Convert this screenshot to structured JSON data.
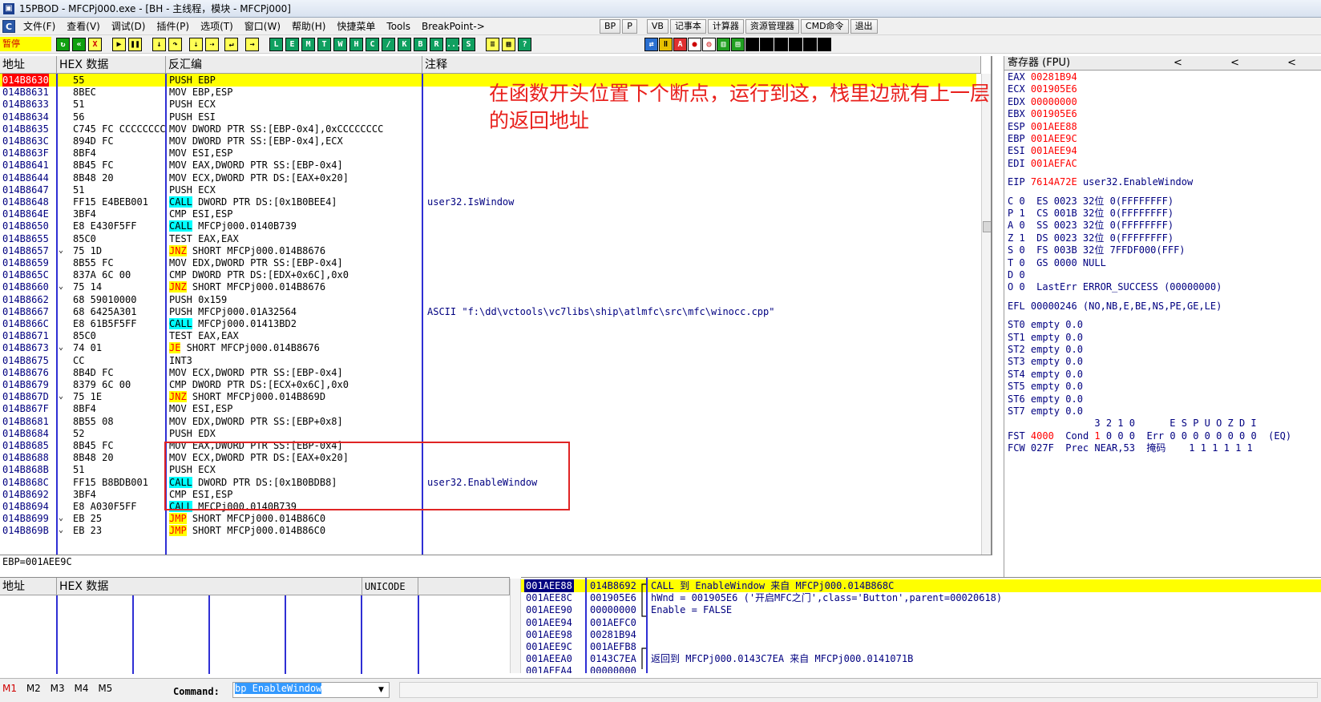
{
  "window": {
    "title": "15PBOD - MFCPj000.exe - [BH - 主线程，模块 - MFCPj000]"
  },
  "menu": {
    "items": [
      "文件(F)",
      "查看(V)",
      "调试(D)",
      "插件(P)",
      "选项(T)",
      "窗口(W)",
      "帮助(H)",
      "快捷菜单",
      "Tools",
      "BreakPoint->"
    ],
    "tool_buttons": [
      "BP",
      "P",
      "VB",
      "记事本",
      "计算器",
      "资源管理器",
      "CMD命令",
      "退出"
    ]
  },
  "toolbar": {
    "status": "暂停",
    "letters": [
      "L",
      "E",
      "M",
      "T",
      "W",
      "H",
      "C",
      "/",
      "K",
      "B",
      "R",
      "...",
      "S"
    ]
  },
  "disasm": {
    "headers": {
      "address": "地址",
      "hex": "HEX 数据",
      "disasm": "反汇编",
      "comment": "注释"
    },
    "rows": [
      {
        "addr": "014B8630",
        "mark": "",
        "hex": "55",
        "kw": "",
        "asm": "PUSH EBP",
        "cmt": "",
        "eip": true
      },
      {
        "addr": "014B8631",
        "mark": "",
        "hex": "8BEC",
        "kw": "",
        "asm": "MOV EBP,ESP",
        "cmt": ""
      },
      {
        "addr": "014B8633",
        "mark": "",
        "hex": "51",
        "kw": "",
        "asm": "PUSH ECX",
        "cmt": ""
      },
      {
        "addr": "014B8634",
        "mark": "",
        "hex": "56",
        "kw": "",
        "asm": "PUSH ESI",
        "cmt": ""
      },
      {
        "addr": "014B8635",
        "mark": "",
        "hex": "C745 FC CCCCCCCC",
        "kw": "",
        "asm": "MOV DWORD PTR SS:[EBP-0x4],0xCCCCCCCC",
        "cmt": ""
      },
      {
        "addr": "014B863C",
        "mark": "",
        "hex": "894D FC",
        "kw": "",
        "asm": "MOV DWORD PTR SS:[EBP-0x4],ECX",
        "cmt": ""
      },
      {
        "addr": "014B863F",
        "mark": "",
        "hex": "8BF4",
        "kw": "",
        "asm": "MOV ESI,ESP",
        "cmt": ""
      },
      {
        "addr": "014B8641",
        "mark": "",
        "hex": "8B45 FC",
        "kw": "",
        "asm": "MOV EAX,DWORD PTR SS:[EBP-0x4]",
        "cmt": ""
      },
      {
        "addr": "014B8644",
        "mark": "",
        "hex": "8B48 20",
        "kw": "",
        "asm": "MOV ECX,DWORD PTR DS:[EAX+0x20]",
        "cmt": ""
      },
      {
        "addr": "014B8647",
        "mark": "",
        "hex": "51",
        "kw": "",
        "asm": "PUSH ECX",
        "cmt": ""
      },
      {
        "addr": "014B8648",
        "mark": "",
        "hex": "FF15 E4BEB001",
        "kw": "CALL",
        "kwtype": "call",
        "asm": " DWORD PTR DS:[0x1B0BEE4]",
        "cmt": "user32.IsWindow"
      },
      {
        "addr": "014B864E",
        "mark": "",
        "hex": "3BF4",
        "kw": "",
        "asm": "CMP ESI,ESP",
        "cmt": ""
      },
      {
        "addr": "014B8650",
        "mark": "",
        "hex": "E8 E430F5FF",
        "kw": "CALL",
        "kwtype": "call",
        "asm": " MFCPj000.0140B739",
        "cmt": ""
      },
      {
        "addr": "014B8655",
        "mark": "",
        "hex": "85C0",
        "kw": "",
        "asm": "TEST EAX,EAX",
        "cmt": ""
      },
      {
        "addr": "014B8657",
        "mark": "⌄",
        "hex": "75 1D",
        "kw": "JNZ",
        "kwtype": "jmp",
        "asm": " SHORT MFCPj000.014B8676",
        "cmt": ""
      },
      {
        "addr": "014B8659",
        "mark": "",
        "hex": "8B55 FC",
        "kw": "",
        "asm": "MOV EDX,DWORD PTR SS:[EBP-0x4]",
        "cmt": ""
      },
      {
        "addr": "014B865C",
        "mark": "",
        "hex": "837A 6C 00",
        "kw": "",
        "asm": "CMP DWORD PTR DS:[EDX+0x6C],0x0",
        "cmt": ""
      },
      {
        "addr": "014B8660",
        "mark": "⌄",
        "hex": "75 14",
        "kw": "JNZ",
        "kwtype": "jmp",
        "asm": " SHORT MFCPj000.014B8676",
        "cmt": ""
      },
      {
        "addr": "014B8662",
        "mark": "",
        "hex": "68 59010000",
        "kw": "",
        "asm": "PUSH 0x159",
        "cmt": ""
      },
      {
        "addr": "014B8667",
        "mark": "",
        "hex": "68 6425A301",
        "kw": "",
        "asm": "PUSH MFCPj000.01A32564",
        "cmt": "ASCII \"f:\\dd\\vctools\\vc7libs\\ship\\atlmfc\\src\\mfc\\winocc.cpp\""
      },
      {
        "addr": "014B866C",
        "mark": "",
        "hex": "E8 61B5F5FF",
        "kw": "CALL",
        "kwtype": "call",
        "asm": " MFCPj000.01413BD2",
        "cmt": ""
      },
      {
        "addr": "014B8671",
        "mark": "",
        "hex": "85C0",
        "kw": "",
        "asm": "TEST EAX,EAX",
        "cmt": ""
      },
      {
        "addr": "014B8673",
        "mark": "⌄",
        "hex": "74 01",
        "kw": "JE",
        "kwtype": "jmp",
        "asm": " SHORT MFCPj000.014B8676",
        "cmt": ""
      },
      {
        "addr": "014B8675",
        "mark": "",
        "hex": "CC",
        "kw": "",
        "asm": "INT3",
        "cmt": ""
      },
      {
        "addr": "014B8676",
        "mark": "",
        "hex": "8B4D FC",
        "kw": "",
        "asm": "MOV ECX,DWORD PTR SS:[EBP-0x4]",
        "cmt": ""
      },
      {
        "addr": "014B8679",
        "mark": "",
        "hex": "8379 6C 00",
        "kw": "",
        "asm": "CMP DWORD PTR DS:[ECX+0x6C],0x0",
        "cmt": ""
      },
      {
        "addr": "014B867D",
        "mark": "⌄",
        "hex": "75 1E",
        "kw": "JNZ",
        "kwtype": "jmp",
        "asm": " SHORT MFCPj000.014B869D",
        "cmt": ""
      },
      {
        "addr": "014B867F",
        "mark": "",
        "hex": "8BF4",
        "kw": "",
        "asm": "MOV ESI,ESP",
        "cmt": ""
      },
      {
        "addr": "014B8681",
        "mark": "",
        "hex": "8B55 08",
        "kw": "",
        "asm": "MOV EDX,DWORD PTR SS:[EBP+0x8]",
        "cmt": ""
      },
      {
        "addr": "014B8684",
        "mark": "",
        "hex": "52",
        "kw": "",
        "asm": "PUSH EDX",
        "cmt": ""
      },
      {
        "addr": "014B8685",
        "mark": "",
        "hex": "8B45 FC",
        "kw": "",
        "asm": "MOV EAX,DWORD PTR SS:[EBP-0x4]",
        "cmt": ""
      },
      {
        "addr": "014B8688",
        "mark": "",
        "hex": "8B48 20",
        "kw": "",
        "asm": "MOV ECX,DWORD PTR DS:[EAX+0x20]",
        "cmt": ""
      },
      {
        "addr": "014B868B",
        "mark": "",
        "hex": "51",
        "kw": "",
        "asm": "PUSH ECX",
        "cmt": ""
      },
      {
        "addr": "014B868C",
        "mark": "",
        "hex": "FF15 B8BDB001",
        "kw": "CALL",
        "kwtype": "call",
        "asm": " DWORD PTR DS:[0x1B0BDB8]",
        "cmt": "user32.EnableWindow"
      },
      {
        "addr": "014B8692",
        "mark": "",
        "hex": "3BF4",
        "kw": "",
        "asm": "CMP ESI,ESP",
        "cmt": ""
      },
      {
        "addr": "014B8694",
        "mark": "",
        "hex": "E8 A030F5FF",
        "kw": "CALL",
        "kwtype": "call",
        "asm": " MFCPj000.0140B739",
        "cmt": ""
      },
      {
        "addr": "014B8699",
        "mark": "⌄",
        "hex": "EB 25",
        "kw": "JMP",
        "kwtype": "jmp",
        "asm": " SHORT MFCPj000.014B86C0",
        "cmt": ""
      },
      {
        "addr": "014B869B",
        "mark": "⌄",
        "hex": "EB 23",
        "kw": "JMP",
        "kwtype": "jmp",
        "asm": " SHORT MFCPj000.014B86C0",
        "cmt": ""
      }
    ],
    "annotation": "在函数开头位置下个断点，运行到这，栈里边就有上一层的返回地址",
    "info_line": "EBP=001AEE9C"
  },
  "registers": {
    "title": "寄存器 (FPU)",
    "arrows": "< < <",
    "gp": [
      {
        "name": "EAX",
        "value": "00281B94",
        "text": ""
      },
      {
        "name": "ECX",
        "value": "001905E6",
        "text": ""
      },
      {
        "name": "EDX",
        "value": "00000000",
        "text": ""
      },
      {
        "name": "EBX",
        "value": "001905E6",
        "text": ""
      },
      {
        "name": "ESP",
        "value": "001AEE88",
        "text": ""
      },
      {
        "name": "EBP",
        "value": "001AEE9C",
        "text": ""
      },
      {
        "name": "ESI",
        "value": "001AEE94",
        "text": ""
      },
      {
        "name": "EDI",
        "value": "001AEFAC",
        "text": ""
      }
    ],
    "eip": {
      "name": "EIP",
      "value": "7614A72E",
      "text": "user32.EnableWindow"
    },
    "flags": [
      "C 0  ES 0023 32位 0(FFFFFFFF)",
      "P 1  CS 001B 32位 0(FFFFFFFF)",
      "A 0  SS 0023 32位 0(FFFFFFFF)",
      "Z 1  DS 0023 32位 0(FFFFFFFF)",
      "S 0  FS 003B 32位 7FFDF000(FFF)",
      "T 0  GS 0000 NULL",
      "D 0",
      "O 0  LastErr ERROR_SUCCESS (00000000)"
    ],
    "efl": "EFL 00000246 (NO,NB,E,BE,NS,PE,GE,LE)",
    "fpu": [
      "ST0 empty 0.0",
      "ST1 empty 0.0",
      "ST2 empty 0.0",
      "ST3 empty 0.0",
      "ST4 empty 0.0",
      "ST5 empty 0.0",
      "ST6 empty 0.0",
      "ST7 empty 0.0"
    ],
    "fpu_hdr": "               3 2 1 0      E S P U O Z D I",
    "fst": {
      "label": "FST",
      "value": "4000",
      "rest": "  Cond ",
      "cond1": "1",
      "rest2": " 0 0 0  Err 0 0 0 0 0 0 0 0  (EQ)"
    },
    "fcw": "FCW 027F  Prec NEAR,53  掩码    1 1 1 1 1 1"
  },
  "dump": {
    "headers": {
      "address": "地址",
      "hex": "HEX 数据",
      "unicode": "UNICODE"
    }
  },
  "stack": {
    "rows": [
      {
        "addr": "001AEE88",
        "val": "014B8692",
        "cmt": "CALL 到 EnableWindow 来自 MFCPj000.014B868C",
        "top": true
      },
      {
        "addr": "001AEE8C",
        "val": "001905E6",
        "cmt": "hWnd = 001905E6 ('开启MFC之门',class='Button',parent=00020618)"
      },
      {
        "addr": "001AEE90",
        "val": "00000000",
        "cmt": "Enable = FALSE"
      },
      {
        "addr": "001AEE94",
        "val": "001AEFC0",
        "cmt": ""
      },
      {
        "addr": "001AEE98",
        "val": "00281B94",
        "cmt": ""
      },
      {
        "addr": "001AEE9C",
        "val": "001AEFB8",
        "cmt": ""
      },
      {
        "addr": "001AEEA0",
        "val": "0143C7EA",
        "cmt": "返回到 MFCPj000.0143C7EA 来自 MFCPj000.0141071B"
      },
      {
        "addr": "001AEEA4",
        "val": "00000000",
        "cmt": ""
      }
    ]
  },
  "command": {
    "tabs": [
      "M1",
      "M2",
      "M3",
      "M4",
      "M5"
    ],
    "label": "Command:",
    "value": "bp EnableWindow"
  }
}
